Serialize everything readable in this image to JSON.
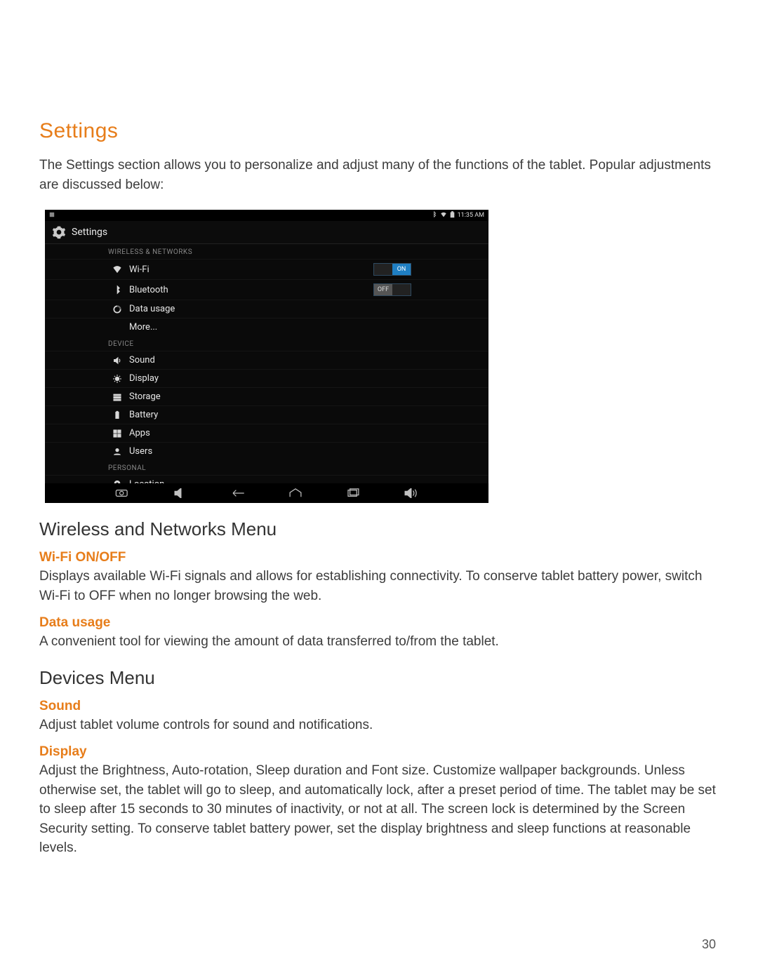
{
  "page_number": "30",
  "title": "Settings",
  "intro": "The Settings section allows you to personalize and adjust many of the functions of the tablet. Popular adjustments are discussed below:",
  "screenshot": {
    "status_time": "11:35 AM",
    "header_title": "Settings",
    "sections": {
      "wireless_label": "WIRELESS & NETWORKS",
      "device_label": "DEVICE",
      "personal_label": "PERSONAL"
    },
    "rows": {
      "wifi": {
        "label": "Wi-Fi",
        "toggle": "ON"
      },
      "bluetooth": {
        "label": "Bluetooth",
        "toggle": "OFF"
      },
      "data": {
        "label": "Data usage"
      },
      "more": {
        "label": "More..."
      },
      "sound": {
        "label": "Sound"
      },
      "display": {
        "label": "Display"
      },
      "storage": {
        "label": "Storage"
      },
      "battery": {
        "label": "Battery"
      },
      "apps": {
        "label": "Apps"
      },
      "users": {
        "label": "Users"
      },
      "location": {
        "label": "Location"
      }
    },
    "toggle_text": {
      "on": "ON",
      "off": "OFF"
    }
  },
  "sections": {
    "wireless": {
      "heading": "Wireless and Networks Menu",
      "wifi": {
        "title": "Wi-Fi ON/OFF",
        "body": "Displays available Wi-Fi signals and allows for establishing connectivity. To conserve tablet battery power, switch Wi-Fi  to OFF when no longer browsing the web."
      },
      "data_usage": {
        "title": "Data usage",
        "body": "A convenient tool for viewing the amount of data transferred to/from the tablet."
      }
    },
    "devices": {
      "heading": "Devices Menu",
      "sound": {
        "title": "Sound",
        "body": "Adjust tablet volume controls for sound and notifications."
      },
      "display": {
        "title": "Display",
        "body": "Adjust the Brightness, Auto-rotation, Sleep duration and Font size. Customize wallpaper backgrounds. Unless otherwise set, the tablet will go to sleep, and automatically lock, after a preset period of time. The tablet may be set to sleep after 15 seconds to 30 minutes of inactivity, or not at all. The screen lock is determined by the Screen Security setting. To conserve tablet battery power, set the display brightness and sleep functions at reasonable levels."
      }
    }
  }
}
